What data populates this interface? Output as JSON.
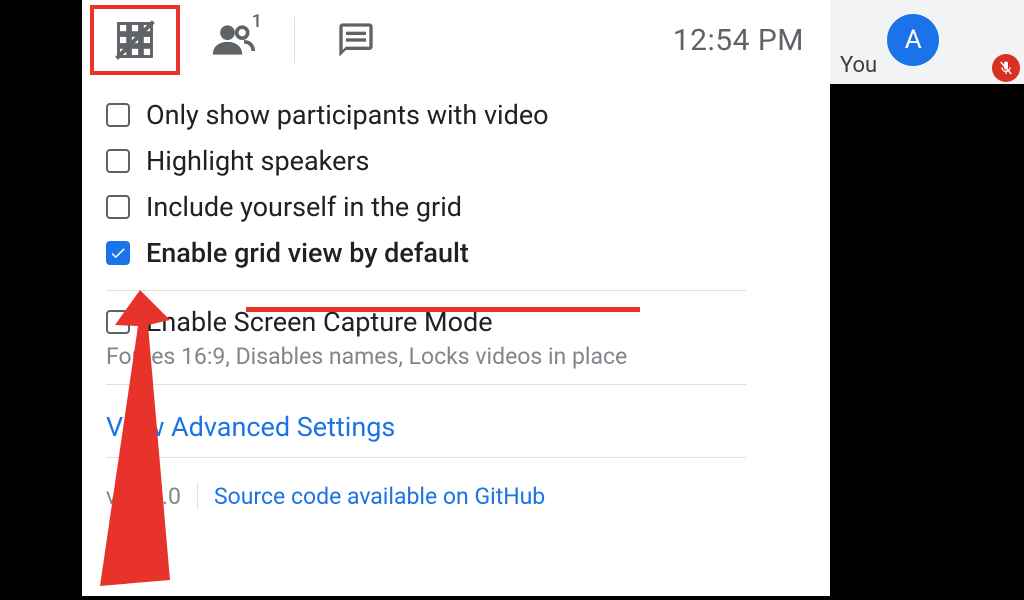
{
  "topbar": {
    "clock": "12:54 PM",
    "icons": {
      "grid": "grid-view-off-icon",
      "people": "people-icon",
      "chat": "chat-icon"
    },
    "people_count": "1"
  },
  "user": {
    "you_label": "You",
    "avatar_initial": "A",
    "mic_muted": true
  },
  "options": [
    {
      "label": "Only show participants with video",
      "checked": false
    },
    {
      "label": "Highlight speakers",
      "checked": false
    },
    {
      "label": "Include yourself in the grid",
      "checked": false
    },
    {
      "label": "Enable grid view by default",
      "checked": true
    }
  ],
  "screen_capture": {
    "label": "Enable Screen Capture Mode",
    "checked": false,
    "desc": "Forces 16:9, Disables names, Locks videos in place"
  },
  "advanced_link": "View Advanced Settings",
  "footer": {
    "version": "v1.39.0",
    "source_link": "Source code available on GitHub"
  },
  "annotation": {
    "underline_target_index": 3
  }
}
